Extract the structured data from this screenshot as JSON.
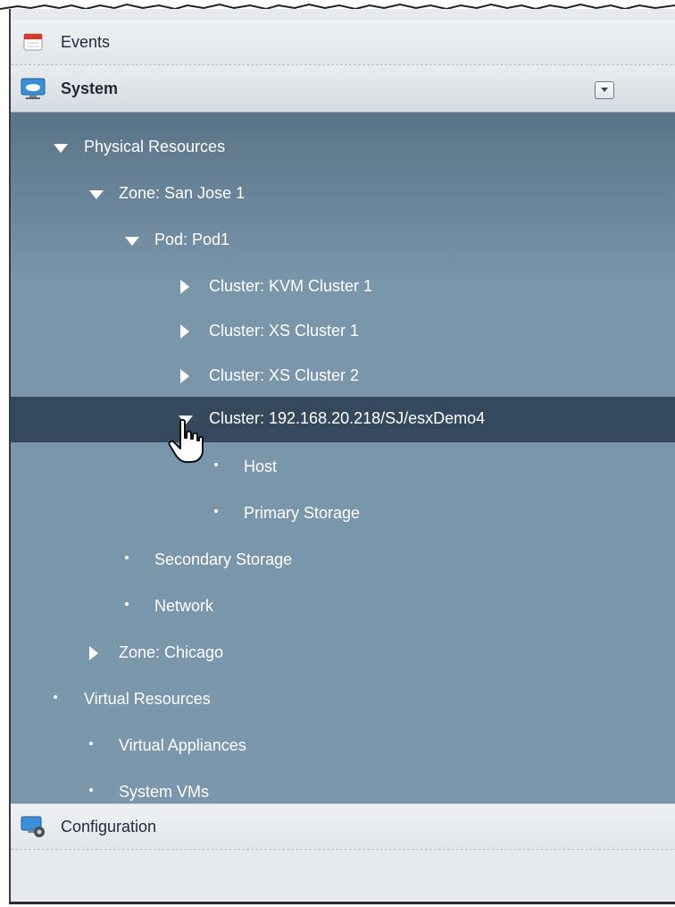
{
  "nav": {
    "events_label": "Events",
    "system_label": "System",
    "configuration_label": "Configuration"
  },
  "tree": {
    "physical_resources": "Physical Resources",
    "zone_san_jose": "Zone: San Jose 1",
    "pod1": "Pod: Pod1",
    "cluster_kvm1": "Cluster: KVM Cluster 1",
    "cluster_xs1": "Cluster: XS Cluster 1",
    "cluster_xs2": "Cluster: XS Cluster 2",
    "cluster_esx": "Cluster: 192.168.20.218/SJ/esxDemo4",
    "host": "Host",
    "primary_storage": "Primary Storage",
    "secondary_storage": "Secondary Storage",
    "network": "Network",
    "zone_chicago": "Zone: Chicago",
    "virtual_resources": "Virtual Resources",
    "virtual_appliances": "Virtual Appliances",
    "system_vms": "System VMs"
  },
  "colors": {
    "tree_background": "#7b97ab",
    "selected_row": "#34495c",
    "header_background": "#e6eaee"
  },
  "icons": {
    "events": "calendar-icon",
    "system": "monitor-cloud-icon",
    "configuration": "monitor-gear-icon",
    "collapse": "chevron-down-icon",
    "cursor": "hand-pointer-icon"
  }
}
